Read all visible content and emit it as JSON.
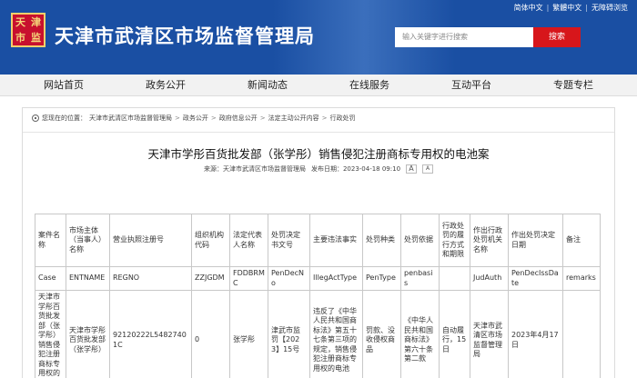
{
  "header": {
    "logo_chars": [
      "天",
      "津",
      "市",
      "监"
    ],
    "site_title": "天津市武清区市场监督管理局",
    "top_links": [
      "简体中文",
      "繁體中文",
      "无障碍浏览"
    ],
    "search_placeholder": "输入关键字进行搜索",
    "search_button": "搜索"
  },
  "nav": [
    "网站首页",
    "政务公开",
    "新闻动态",
    "在线服务",
    "互动平台",
    "专题专栏"
  ],
  "breadcrumb": {
    "prefix": "您现在的位置：",
    "items": [
      "天津市武清区市场监督管理局",
      "政务公开",
      "政府信息公开",
      "法定主动公开内容",
      "行政处罚"
    ]
  },
  "article": {
    "title": "天津市学彤百货批发部（张学彤）销售侵犯注册商标专用权的电池案",
    "source": "来源：天津市武清区市场监督管理局",
    "date": "发布日期：2023-04-18 09:10",
    "font_large": "A",
    "font_small": "A"
  },
  "table": {
    "headers": [
      "案件名称",
      "市场主体（当事人）名称",
      "营业执照注册号",
      "组织机构代码",
      "法定代表人名称",
      "处罚决定书文号",
      "主要违法事实",
      "处罚种类",
      "处罚依据",
      "行政处罚的履行方式和期限",
      "作出行政处罚机关名称",
      "作出处罚决定日期",
      "备注"
    ],
    "fields": [
      "Case",
      "ENTNAME",
      "REGNO",
      "ZZJGDM",
      "FDDBRMC",
      "PenDecNo",
      "IllegActType",
      "PenType",
      "penbasis",
      "",
      "JudAuth",
      "PenDecIssDate",
      "remarks"
    ],
    "row": [
      "天津市学彤百货批发部（张学彤）销售侵犯注册商标专用权的电池案",
      "天津市学彤百货批发部（张学彤）",
      "92120222L54827401C",
      "0",
      "张学彤",
      "津武市监罚【2023】15号",
      "违反了《中华人民共和国商标法》第五十七条第三项的规定，销售侵犯注册商标专用权的电池",
      "罚款、没收侵权商品",
      "《中华人民共和国商标法》第六十条第二款",
      "自动履行，15日",
      "天津市武清区市场监督管理局",
      "2023年4月17日",
      ""
    ]
  }
}
